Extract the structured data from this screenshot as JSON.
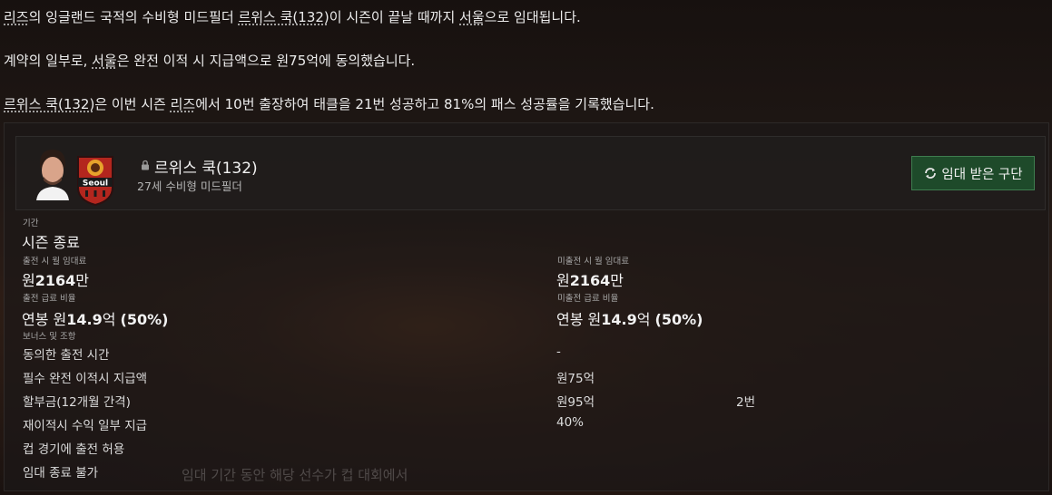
{
  "news": {
    "p1": {
      "club": "리즈",
      "t1": "의 잉글랜드 국적의 수비형 미드필더 ",
      "player": "르위스 쿡(132)",
      "t2": "이 시즌이 끝날 때까지 ",
      "dest": "서울",
      "t3": "으로 임대됩니다."
    },
    "p2": {
      "t1": "계약의 일부로, ",
      "dest": "서울",
      "t2": "은 완전 이적 시 지급액으로 원75억에 동의했습니다."
    },
    "p3": {
      "player": "르위스 쿡(132)",
      "t1": "은 이번 시즌 ",
      "club": "리즈",
      "t2": "에서 10번 출장하여 태클을 21번 성공하고 81%의 패스 성공률을 기록했습니다."
    }
  },
  "card": {
    "player_name": "르위스 쿡(132)",
    "player_sub": "27세 수비형 미드필더",
    "crest_text": "Seoul",
    "loan_button": "임대 받은 구단",
    "duration_label": "기간",
    "duration_value": "시즌 종료",
    "played_fee_label": "출전 시 월 임대료",
    "played_fee_prefix": "원",
    "played_fee_value": "2164",
    "played_fee_suffix": "만",
    "unplayed_fee_label": "미출전 시 월 임대료",
    "unplayed_fee_prefix": "원",
    "unplayed_fee_value": "2164",
    "unplayed_fee_suffix": "만",
    "played_wage_label": "출전 급료 비율",
    "played_wage_prefix": "연봉 원",
    "played_wage_value": "14.9",
    "played_wage_mid": "억 ",
    "played_wage_pct": "(50%)",
    "unplayed_wage_label": "미출전 급료 비율",
    "unplayed_wage_prefix": "연봉 원",
    "unplayed_wage_value": "14.9",
    "unplayed_wage_mid": "억 ",
    "unplayed_wage_pct": "(50%)",
    "bonus_label": "보너스 및 조항",
    "clauses": [
      {
        "name": "동의한 출전 시간",
        "value": "-",
        "extra": ""
      },
      {
        "name": "필수 완전 이적시 지급액",
        "value": "원75억",
        "extra": ""
      },
      {
        "name": "할부금(12개월 간격)",
        "value": "원95억",
        "extra": "2번"
      },
      {
        "name": "재이적시 수익 일부 지급",
        "value": "40%",
        "extra": ""
      },
      {
        "name": "컵 경기에 출전 허용",
        "value": "",
        "extra": ""
      },
      {
        "name": "임대 종료 불가",
        "value": "",
        "extra": ""
      }
    ],
    "tooltip_ghost": "임대 기간 동안 해당 선수가 컵 대회에서"
  }
}
